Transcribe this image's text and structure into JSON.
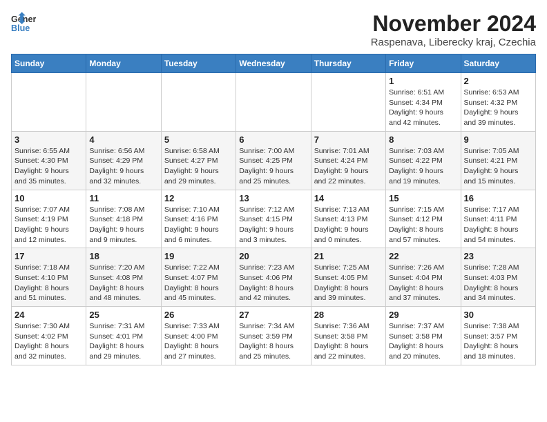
{
  "logo": {
    "line1": "General",
    "line2": "Blue"
  },
  "title": "November 2024",
  "subtitle": "Raspenava, Liberecky kraj, Czechia",
  "weekdays": [
    "Sunday",
    "Monday",
    "Tuesday",
    "Wednesday",
    "Thursday",
    "Friday",
    "Saturday"
  ],
  "weeks": [
    [
      {
        "day": "",
        "info": ""
      },
      {
        "day": "",
        "info": ""
      },
      {
        "day": "",
        "info": ""
      },
      {
        "day": "",
        "info": ""
      },
      {
        "day": "",
        "info": ""
      },
      {
        "day": "1",
        "info": "Sunrise: 6:51 AM\nSunset: 4:34 PM\nDaylight: 9 hours\nand 42 minutes."
      },
      {
        "day": "2",
        "info": "Sunrise: 6:53 AM\nSunset: 4:32 PM\nDaylight: 9 hours\nand 39 minutes."
      }
    ],
    [
      {
        "day": "3",
        "info": "Sunrise: 6:55 AM\nSunset: 4:30 PM\nDaylight: 9 hours\nand 35 minutes."
      },
      {
        "day": "4",
        "info": "Sunrise: 6:56 AM\nSunset: 4:29 PM\nDaylight: 9 hours\nand 32 minutes."
      },
      {
        "day": "5",
        "info": "Sunrise: 6:58 AM\nSunset: 4:27 PM\nDaylight: 9 hours\nand 29 minutes."
      },
      {
        "day": "6",
        "info": "Sunrise: 7:00 AM\nSunset: 4:25 PM\nDaylight: 9 hours\nand 25 minutes."
      },
      {
        "day": "7",
        "info": "Sunrise: 7:01 AM\nSunset: 4:24 PM\nDaylight: 9 hours\nand 22 minutes."
      },
      {
        "day": "8",
        "info": "Sunrise: 7:03 AM\nSunset: 4:22 PM\nDaylight: 9 hours\nand 19 minutes."
      },
      {
        "day": "9",
        "info": "Sunrise: 7:05 AM\nSunset: 4:21 PM\nDaylight: 9 hours\nand 15 minutes."
      }
    ],
    [
      {
        "day": "10",
        "info": "Sunrise: 7:07 AM\nSunset: 4:19 PM\nDaylight: 9 hours\nand 12 minutes."
      },
      {
        "day": "11",
        "info": "Sunrise: 7:08 AM\nSunset: 4:18 PM\nDaylight: 9 hours\nand 9 minutes."
      },
      {
        "day": "12",
        "info": "Sunrise: 7:10 AM\nSunset: 4:16 PM\nDaylight: 9 hours\nand 6 minutes."
      },
      {
        "day": "13",
        "info": "Sunrise: 7:12 AM\nSunset: 4:15 PM\nDaylight: 9 hours\nand 3 minutes."
      },
      {
        "day": "14",
        "info": "Sunrise: 7:13 AM\nSunset: 4:13 PM\nDaylight: 9 hours\nand 0 minutes."
      },
      {
        "day": "15",
        "info": "Sunrise: 7:15 AM\nSunset: 4:12 PM\nDaylight: 8 hours\nand 57 minutes."
      },
      {
        "day": "16",
        "info": "Sunrise: 7:17 AM\nSunset: 4:11 PM\nDaylight: 8 hours\nand 54 minutes."
      }
    ],
    [
      {
        "day": "17",
        "info": "Sunrise: 7:18 AM\nSunset: 4:10 PM\nDaylight: 8 hours\nand 51 minutes."
      },
      {
        "day": "18",
        "info": "Sunrise: 7:20 AM\nSunset: 4:08 PM\nDaylight: 8 hours\nand 48 minutes."
      },
      {
        "day": "19",
        "info": "Sunrise: 7:22 AM\nSunset: 4:07 PM\nDaylight: 8 hours\nand 45 minutes."
      },
      {
        "day": "20",
        "info": "Sunrise: 7:23 AM\nSunset: 4:06 PM\nDaylight: 8 hours\nand 42 minutes."
      },
      {
        "day": "21",
        "info": "Sunrise: 7:25 AM\nSunset: 4:05 PM\nDaylight: 8 hours\nand 39 minutes."
      },
      {
        "day": "22",
        "info": "Sunrise: 7:26 AM\nSunset: 4:04 PM\nDaylight: 8 hours\nand 37 minutes."
      },
      {
        "day": "23",
        "info": "Sunrise: 7:28 AM\nSunset: 4:03 PM\nDaylight: 8 hours\nand 34 minutes."
      }
    ],
    [
      {
        "day": "24",
        "info": "Sunrise: 7:30 AM\nSunset: 4:02 PM\nDaylight: 8 hours\nand 32 minutes."
      },
      {
        "day": "25",
        "info": "Sunrise: 7:31 AM\nSunset: 4:01 PM\nDaylight: 8 hours\nand 29 minutes."
      },
      {
        "day": "26",
        "info": "Sunrise: 7:33 AM\nSunset: 4:00 PM\nDaylight: 8 hours\nand 27 minutes."
      },
      {
        "day": "27",
        "info": "Sunrise: 7:34 AM\nSunset: 3:59 PM\nDaylight: 8 hours\nand 25 minutes."
      },
      {
        "day": "28",
        "info": "Sunrise: 7:36 AM\nSunset: 3:58 PM\nDaylight: 8 hours\nand 22 minutes."
      },
      {
        "day": "29",
        "info": "Sunrise: 7:37 AM\nSunset: 3:58 PM\nDaylight: 8 hours\nand 20 minutes."
      },
      {
        "day": "30",
        "info": "Sunrise: 7:38 AM\nSunset: 3:57 PM\nDaylight: 8 hours\nand 18 minutes."
      }
    ]
  ]
}
